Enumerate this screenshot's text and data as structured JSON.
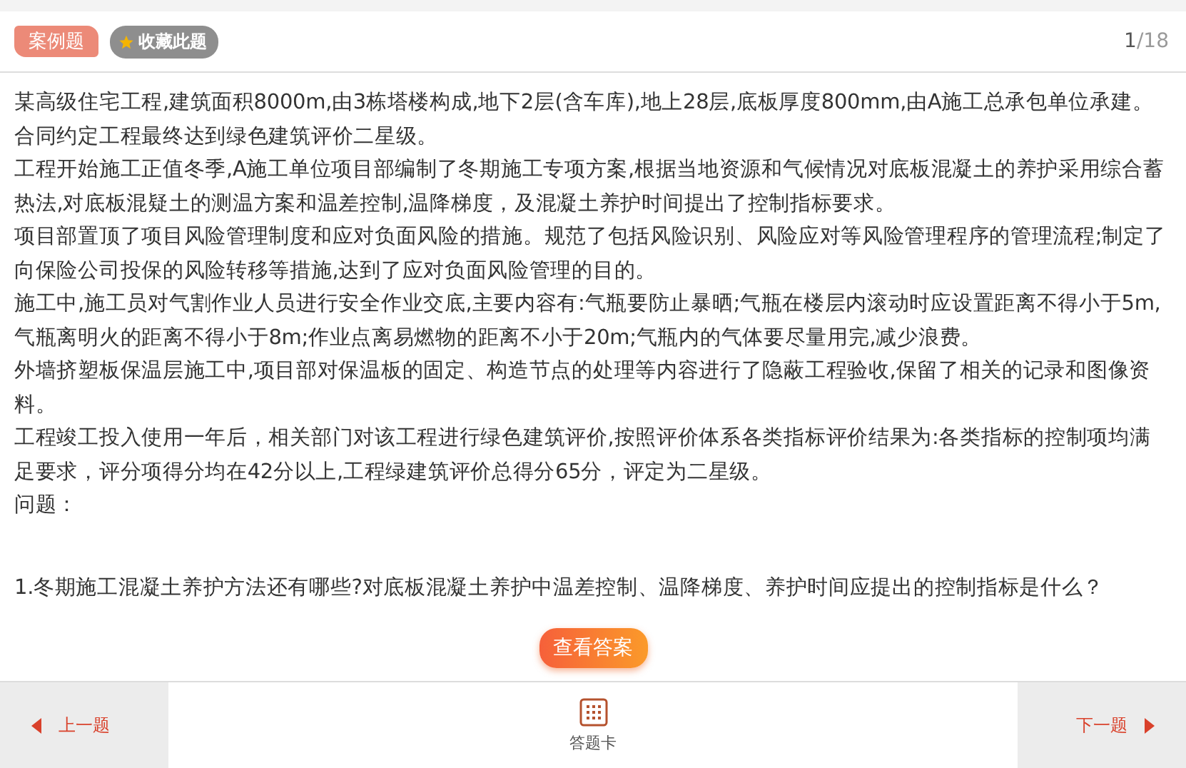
{
  "header": {
    "type_tag": "案例题",
    "favorite": {
      "label": "收藏此题",
      "starred": true
    },
    "current": "1",
    "total": "/18"
  },
  "paragraphs": [
    "某高级住宅工程,建筑面积8000m,由3栋塔楼构成,地下2层(含车库),地上28层,底板厚度800mm,由A施工总承包单位承建。合同约定工程最终达到绿色建筑评价二星级。",
    "工程开始施工正值冬季,A施工单位项目部编制了冬期施工专项方案,根据当地资源和气候情况对底板混凝土的养护采用综合蓄热法,对底板混疑土的测温方案和温差控制,温降梯度，及混凝土养护时间提出了控制指标要求。",
    "项目部置顶了项目风险管理制度和应对负面风险的措施。规范了包括风险识别、风险应对等风险管理程序的管理流程;制定了向保险公司投保的风险转移等措施,达到了应对负面风险管理的目的。",
    "施工中,施工员对气割作业人员进行安全作业交底,主要内容有:气瓶要防止暴晒;气瓶在楼层内滚动时应设置距离不得小于5m,气瓶离明火的距离不得小于8m;作业点离易燃物的距离不小于20m;气瓶内的气体要尽量用完,减少浪费。",
    "外墙挤塑板保温层施工中,项目部对保温板的固定、构造节点的处理等内容进行了隐蔽工程验收,保留了相关的记录和图像资料。",
    "工程竣工投入使用一年后，相关部门对该工程进行绿色建筑评价,按照评价体系各类指标评价结果为:各类指标的控制项均满足要求，评分项得分均在42分以上,工程绿建筑评价总得分65分，评定为二星级。",
    "问题："
  ],
  "question": "1.冬期施工混凝土养护方法还有哪些?对底板混凝土养护中温差控制、温降梯度、养护时间应提出的控制指标是什么？",
  "answer_button": "查看答案",
  "footer": {
    "prev": "上一题",
    "card": "答题卡",
    "next": "下一题"
  }
}
